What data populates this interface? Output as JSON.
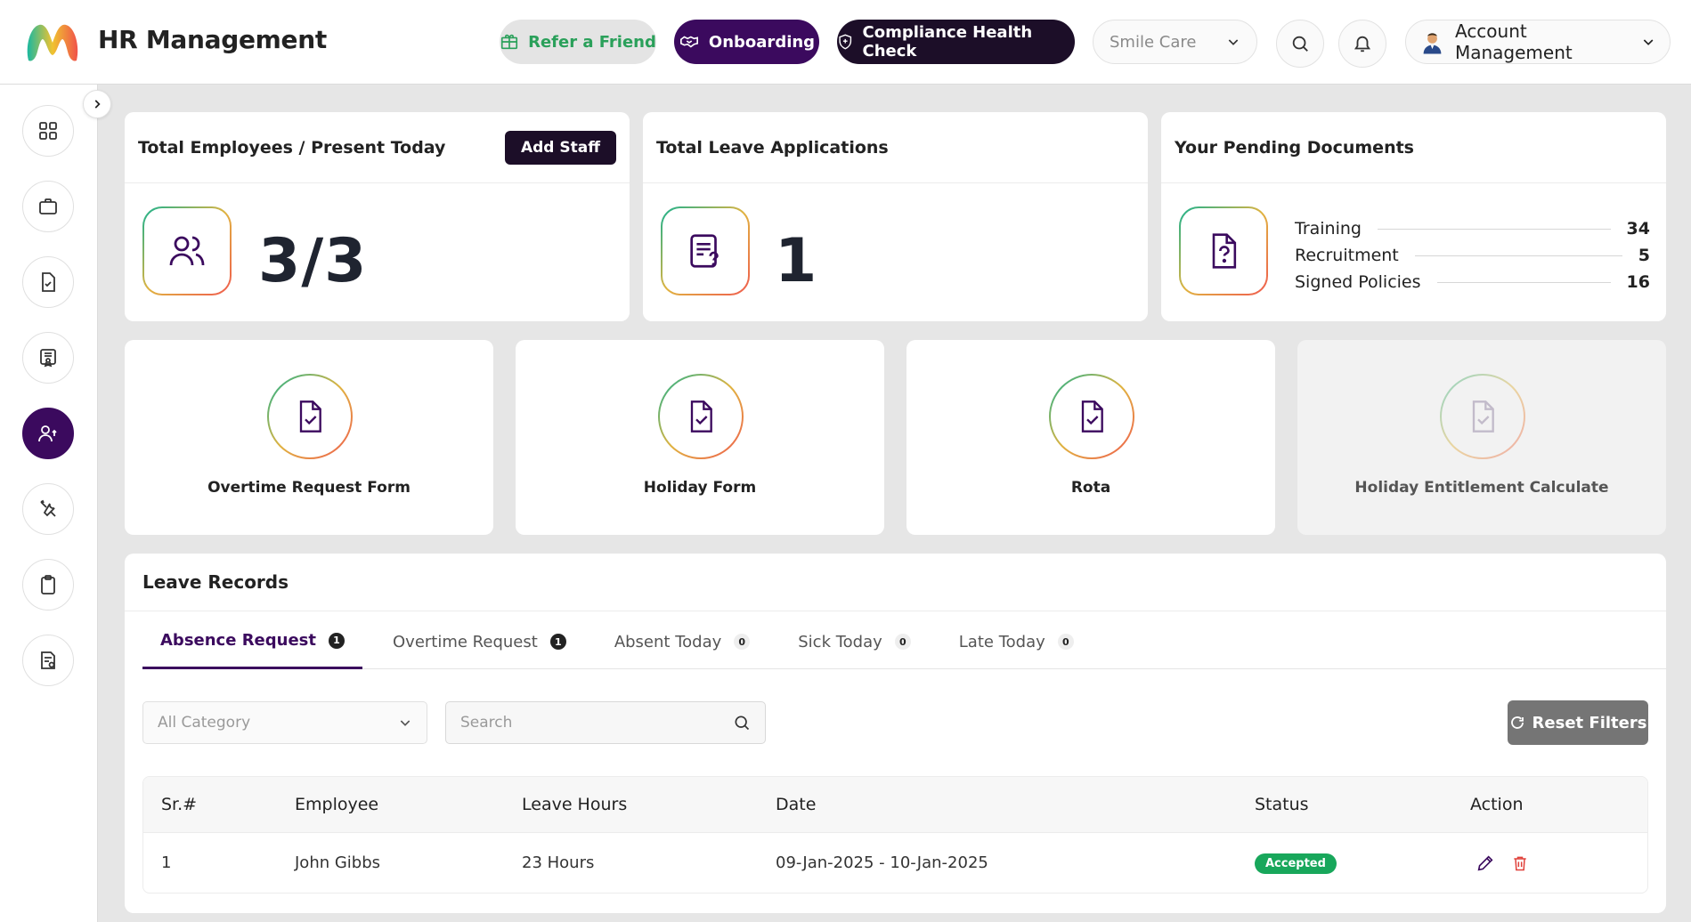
{
  "header": {
    "title": "HR Management",
    "refer_label": "Refer a Friend",
    "onboarding_label": "Onboarding",
    "compliance_label": "Compliance Health Check",
    "org_select": "Smile Care",
    "account_label": "Account Management",
    "colors": {
      "brand_dark": "#3b0a5e",
      "refer_green": "#2aa05a"
    }
  },
  "sidebar": {
    "items": [
      {
        "icon": "grid-icon",
        "active": false
      },
      {
        "icon": "briefcase-icon",
        "active": false
      },
      {
        "icon": "document-check-icon",
        "active": false
      },
      {
        "icon": "certificate-icon",
        "active": false
      },
      {
        "icon": "users-icon",
        "active": true
      },
      {
        "icon": "tools-icon",
        "active": false
      },
      {
        "icon": "clipboard-icon",
        "active": false
      },
      {
        "icon": "report-icon",
        "active": false
      }
    ]
  },
  "stats": {
    "employees": {
      "title": "Total Employees / Present Today",
      "value": "3/3",
      "button": "Add Staff"
    },
    "leave": {
      "title": "Total Leave Applications",
      "value": "1"
    },
    "documents": {
      "title": "Your Pending Documents",
      "rows": [
        {
          "label": "Training",
          "value": "34"
        },
        {
          "label": "Recruitment",
          "value": "5"
        },
        {
          "label": "Signed Policies",
          "value": "16"
        }
      ]
    }
  },
  "forms": [
    {
      "label": "Overtime Request Form",
      "disabled": false
    },
    {
      "label": "Holiday Form",
      "disabled": false
    },
    {
      "label": "Rota",
      "disabled": false
    },
    {
      "label": "Holiday Entitlement Calculate",
      "disabled": true
    }
  ],
  "records": {
    "title": "Leave Records",
    "tabs": [
      {
        "label": "Absence Request",
        "count": "1",
        "active": true
      },
      {
        "label": "Overtime Request",
        "count": "1",
        "active": false
      },
      {
        "label": "Absent Today",
        "count": "0",
        "active": false
      },
      {
        "label": "Sick Today",
        "count": "0",
        "active": false
      },
      {
        "label": "Late Today",
        "count": "0",
        "active": false
      }
    ],
    "category_placeholder": "All Category",
    "search_placeholder": "Search",
    "reset_label": "Reset Filters",
    "columns": [
      "Sr.#",
      "Employee",
      "Leave Hours",
      "Date",
      "Status",
      "Action"
    ],
    "rows": [
      {
        "sr": "1",
        "employee": "John Gibbs",
        "hours": "23 Hours",
        "date": "09-Jan-2025 - 10-Jan-2025",
        "status": "Accepted"
      }
    ],
    "status_color": "#18a75b"
  }
}
